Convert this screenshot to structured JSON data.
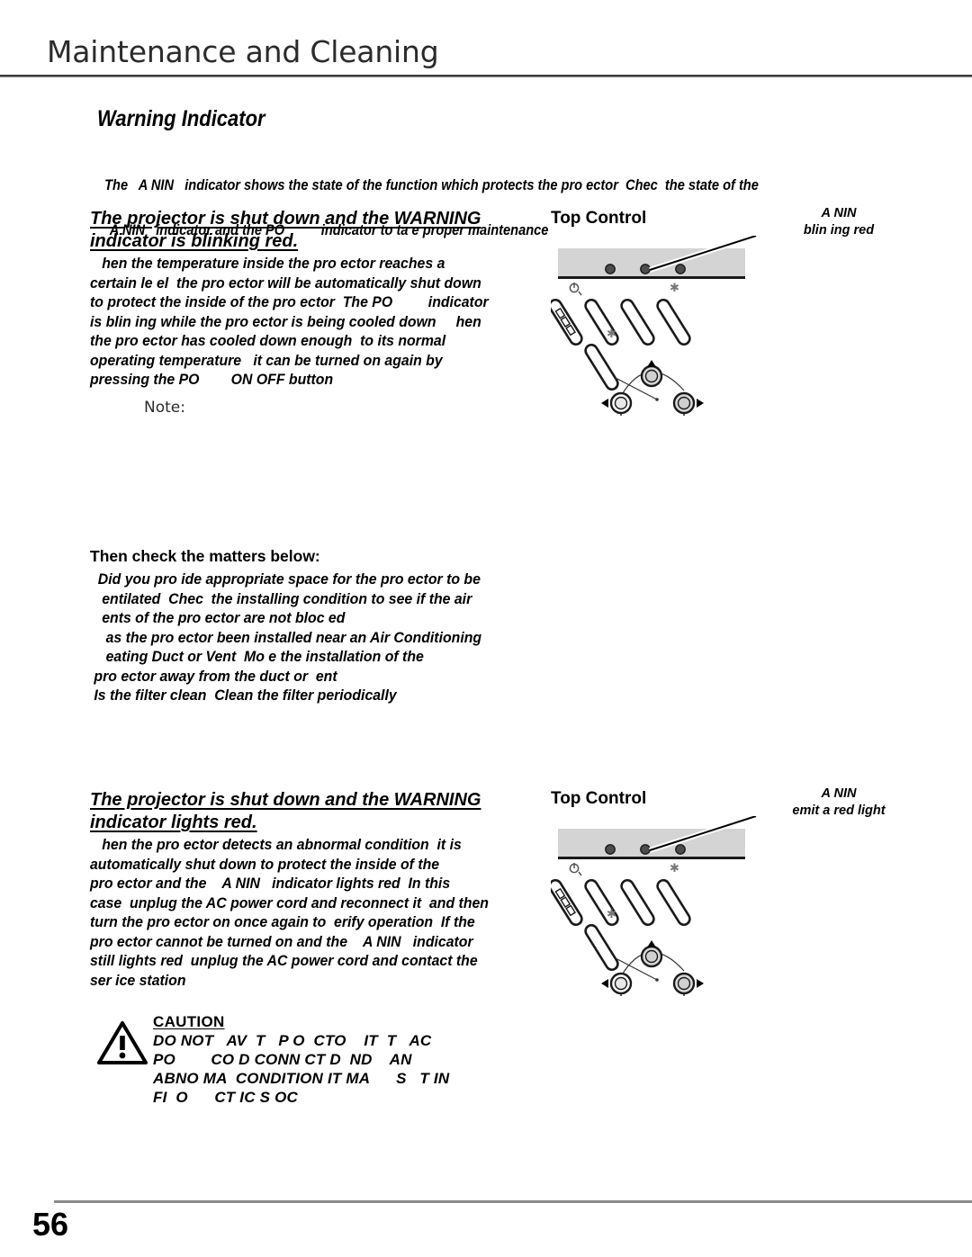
{
  "header": {
    "title": "Maintenance and Cleaning"
  },
  "section": {
    "heading": "Warning Indicator",
    "intro_line_1": "The   A NIN   indicator shows the state of the function which protects the pro ector  Chec  the state of the",
    "intro_line_2": "A NIN   indicator and the PO          indicator to ta e proper maintenance"
  },
  "block_1": {
    "heading": "The projector is shut down and the WARNING indicator is blinking red.",
    "body": "   hen the temperature inside the pro ector reaches a\ncertain le el  the pro ector will be automatically shut down\nto protect the inside of the pro ector  The PO         indicator\nis blin ing while the pro ector is being cooled down     hen\nthe pro ector has cooled down enough  to its normal\noperating temperature   it can be turned on again by\npressing the PO        ON OFF button",
    "note_label": "Note:"
  },
  "checklist": {
    "heading": "Then check the matters below:",
    "lines": "  Did you pro ide appropriate space for the pro ector to be\n   entilated  Chec  the installing condition to see if the air\n   ents of the pro ector are not bloc ed\n    as the pro ector been installed near an Air Conditioning\n    eating Duct or Vent  Mo e the installation of the\n pro ector away from the duct or  ent\n Is the filter clean  Clean the filter periodically"
  },
  "block_2": {
    "heading": "The projector is shut down and the WARNING indicator lights red.",
    "body": "   hen the pro ector detects an abnormal condition  it is\nautomatically shut down to protect the inside of the\npro ector and the    A NIN   indicator lights red  In this\ncase  unplug the AC power cord and reconnect it  and then\nturn the pro ector on once again to  erify operation  If the\npro ector cannot be turned on and the    A NIN   indicator\nstill lights red  unplug the AC power cord and contact the\nser ice station"
  },
  "caution": {
    "title": "CAUTION",
    "text": "DO NOT   AV  T   P O  CTO    IT  T   AC\nPO        CO D CONN CT D  ND    AN\nABNO MA  CONDITION IT MA      S   T IN\nFI  O      CT IC S OC"
  },
  "illustration_1": {
    "title": "Top Control",
    "callout_line_1": "A NIN",
    "callout_line_2": "blin ing red"
  },
  "illustration_2": {
    "title": "Top Control",
    "callout_line_1": "A NIN",
    "callout_line_2": "emit a red light"
  },
  "footer": {
    "page_number": "56"
  },
  "colors": {
    "panel_grey": "#d4d4d4",
    "indicator_dot": "#4d4d4d",
    "rule_grey": "#8a8a8a"
  }
}
